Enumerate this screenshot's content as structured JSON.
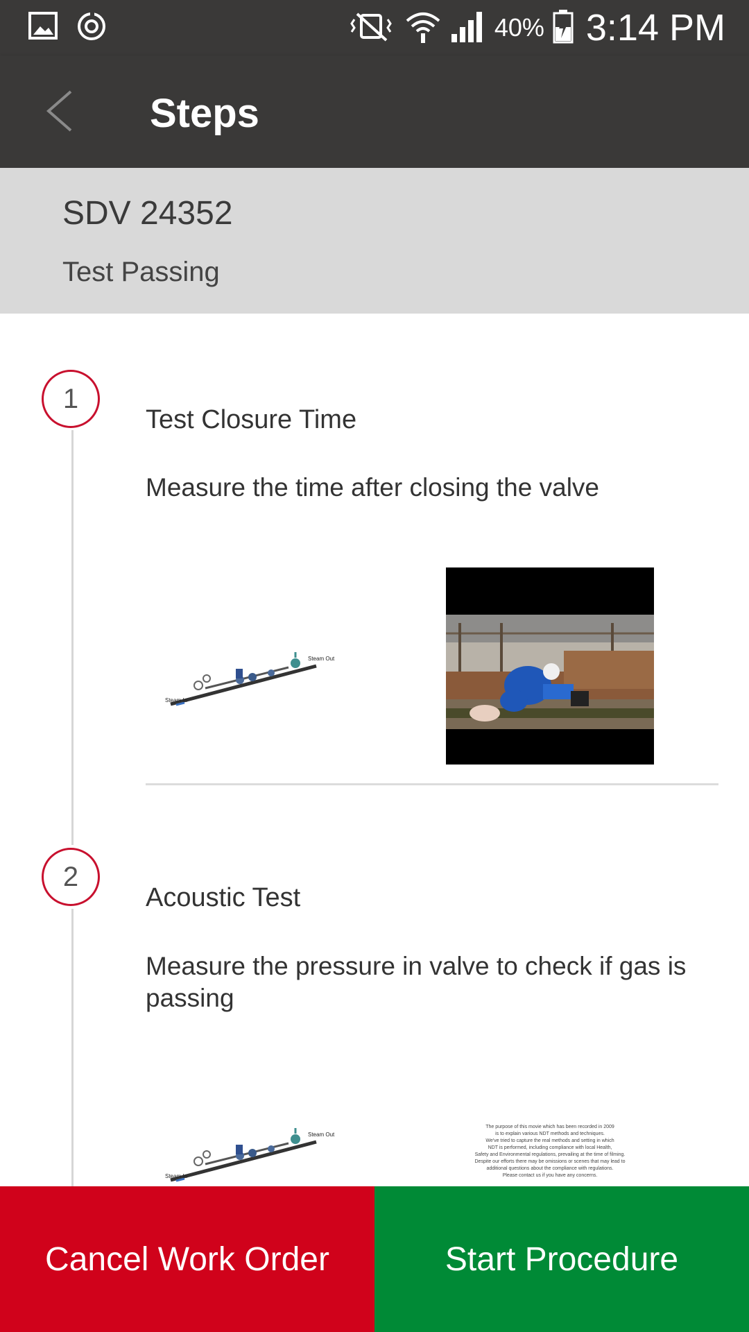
{
  "status_bar": {
    "icons": [
      "gallery-icon",
      "sync-icon",
      "vibrate-mute-icon",
      "wifi-icon",
      "cell-signal-icon",
      "battery-charging-icon"
    ],
    "battery_text": "40%",
    "battery_level": 0.4,
    "time": "3:14 PM"
  },
  "app_bar": {
    "title": "Steps"
  },
  "header": {
    "title": "SDV 24352",
    "subtitle": "Test Passing"
  },
  "steps": [
    {
      "number": "1",
      "title": "Test Closure Time",
      "description": "Measure the time after closing the valve",
      "diagram": {
        "label_in": "Steam In",
        "label_out": "Steam Out"
      },
      "media": "video-thumbnail"
    },
    {
      "number": "2",
      "title": "Acoustic Test",
      "description": "Measure the pressure in valve to check if gas is passing",
      "diagram": {
        "label_in": "Steam In",
        "label_out": "Steam Out"
      },
      "document_lines": [
        "The purpose of this movie which has been recorded in 2009",
        "is to explain various NDT methods and techniques.",
        "We've tried to capture the real methods and setting in which",
        "NDT is performed, including compliance with local Health,",
        "Safety and Environmental regulations, prevailing at the time of filming.",
        "Despite our efforts there may be omissions or scenes that may lead to",
        "additional questions about the compliance with regulations.",
        "Please contact us if you have any concerns."
      ]
    }
  ],
  "actions": {
    "cancel_label": "Cancel Work Order",
    "start_label": "Start Procedure"
  },
  "colors": {
    "bar": "#3a3938",
    "header": "#d9d9d9",
    "cancel": "#d0021b",
    "start": "#008a36",
    "step_ring": "#c8102e"
  }
}
